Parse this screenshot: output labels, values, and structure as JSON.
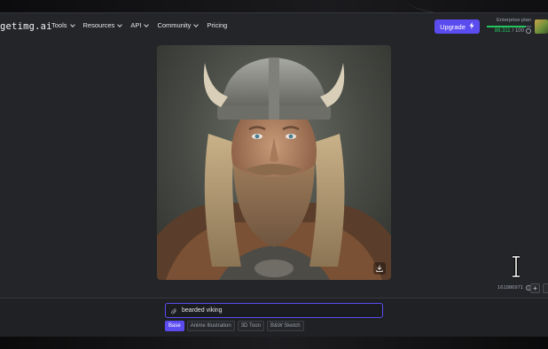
{
  "header": {
    "logo": "getimg.ai",
    "nav": [
      {
        "label": "Tools",
        "has_dropdown": true
      },
      {
        "label": "Resources",
        "has_dropdown": true
      },
      {
        "label": "API",
        "has_dropdown": true
      },
      {
        "label": "Community",
        "has_dropdown": true
      },
      {
        "label": "Pricing",
        "has_dropdown": false
      }
    ],
    "upgrade_label": "Upgrade",
    "plan": {
      "name": "Enterprise plan",
      "credits_used": "88.311",
      "credits_total": "/ 100",
      "usage_fraction": 0.88
    },
    "avatar_icon": "user-avatar"
  },
  "main": {
    "image_subject": "bearded viking portrait",
    "download_icon": "download-icon",
    "seed": "161986971"
  },
  "prompt": {
    "value": "bearded viking",
    "icon": "paperclip-icon"
  },
  "styles": [
    {
      "label": "Base",
      "active": true
    },
    {
      "label": "Anime Illustration",
      "active": false
    },
    {
      "label": "3D Toon",
      "active": false
    },
    {
      "label": "B&W Sketch",
      "active": false
    }
  ],
  "colors": {
    "accent": "#5b4cf0",
    "background": "#242528",
    "credits_green": "#22c55e"
  }
}
